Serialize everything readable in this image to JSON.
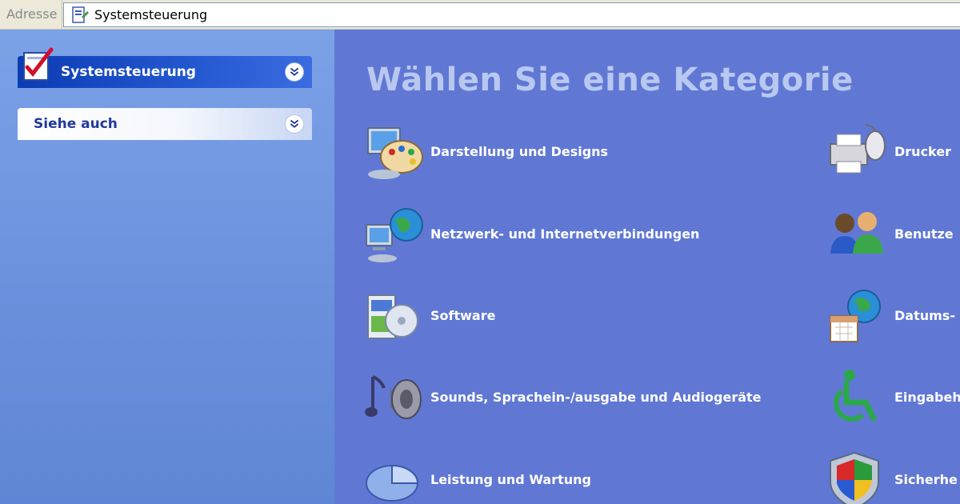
{
  "address_bar": {
    "label": "Adresse",
    "value": "Systemsteuerung",
    "icon": "control-panel-icon"
  },
  "task_pane": {
    "control_panel": {
      "title": "Systemsteuerung",
      "icon": "control-panel-checkmark-icon"
    },
    "see_also": {
      "title": "Siehe auch"
    }
  },
  "main": {
    "heading": "Wählen Sie eine Kategorie",
    "categories": [
      {
        "label": "Darstellung und Designs",
        "icon": "appearance-palette-icon"
      },
      {
        "label": "Netzwerk- und Internetverbindungen",
        "icon": "network-globe-icon"
      },
      {
        "label": "Software",
        "icon": "software-box-cd-icon"
      },
      {
        "label": "Sounds, Sprachein-/ausgabe und Audiogeräte",
        "icon": "sound-speaker-icon"
      },
      {
        "label": "Leistung und Wartung",
        "icon": "performance-pie-icon"
      },
      {
        "label": "Drucker",
        "icon": "printer-icon"
      },
      {
        "label": "Benutze",
        "icon": "users-icon"
      },
      {
        "label": "Datums-",
        "icon": "date-globe-calendar-icon"
      },
      {
        "label": "Eingabeh",
        "icon": "accessibility-icon"
      },
      {
        "label": "Sicherhe",
        "icon": "security-shield-icon"
      }
    ]
  },
  "colors": {
    "main_background": "#6078d4",
    "task_pane_background": "#7ba2e7",
    "heading_text": "#b9c8f0",
    "header_dark_blue": "#0c3cb4"
  }
}
